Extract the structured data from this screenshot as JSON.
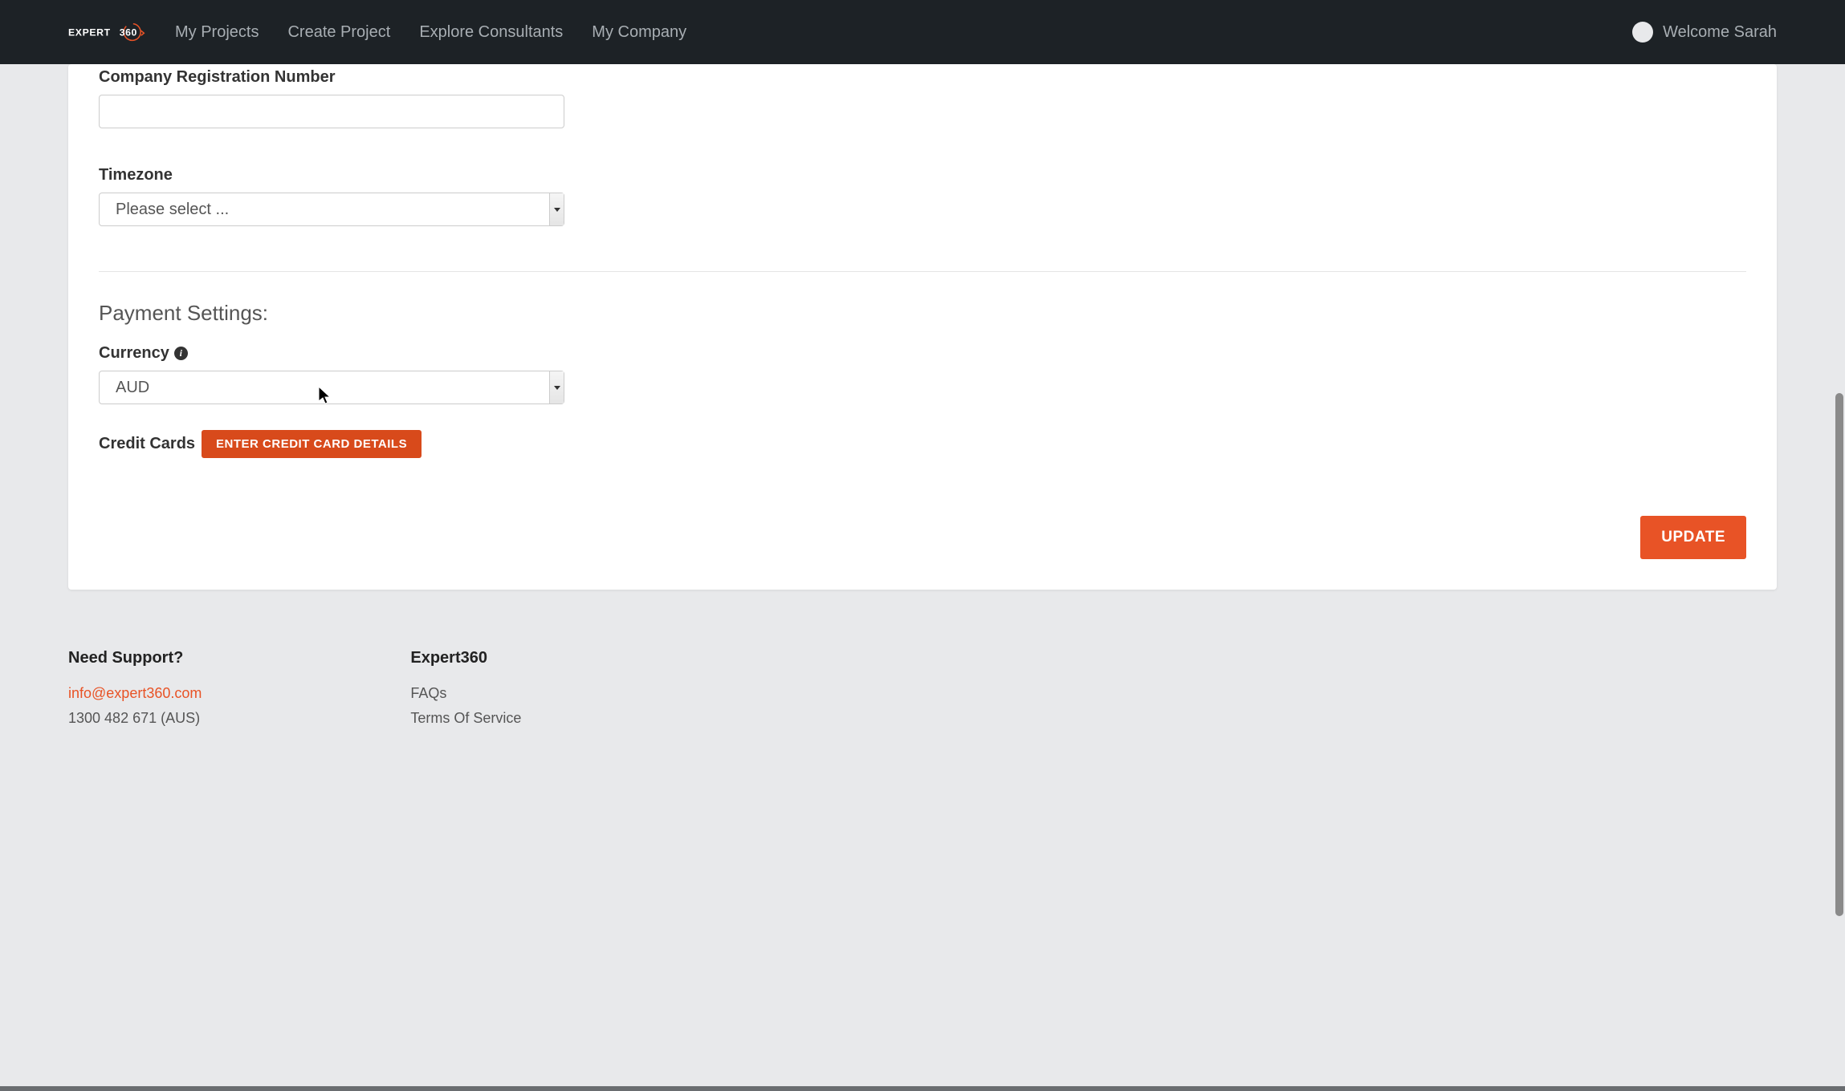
{
  "header": {
    "logo_text_1": "EXPERT",
    "logo_text_2": "360",
    "nav": [
      "My Projects",
      "Create Project",
      "Explore Consultants",
      "My Company"
    ],
    "welcome": "Welcome Sarah"
  },
  "form": {
    "company_reg_label": "Company Registration Number",
    "company_reg_value": "",
    "timezone_label": "Timezone",
    "timezone_value": "Please select ...",
    "payment_heading": "Payment Settings:",
    "currency_label": "Currency",
    "currency_value": "AUD",
    "credit_cards_label": "Credit Cards",
    "enter_cc_button": "ENTER CREDIT CARD DETAILS",
    "update_button": "UPDATE"
  },
  "footer": {
    "support_heading": "Need Support?",
    "support_email": "info@expert360.com",
    "support_phone": "1300 482 671 (AUS)",
    "company_heading": "Expert360",
    "faqs": "FAQs",
    "terms": "Terms Of Service"
  }
}
